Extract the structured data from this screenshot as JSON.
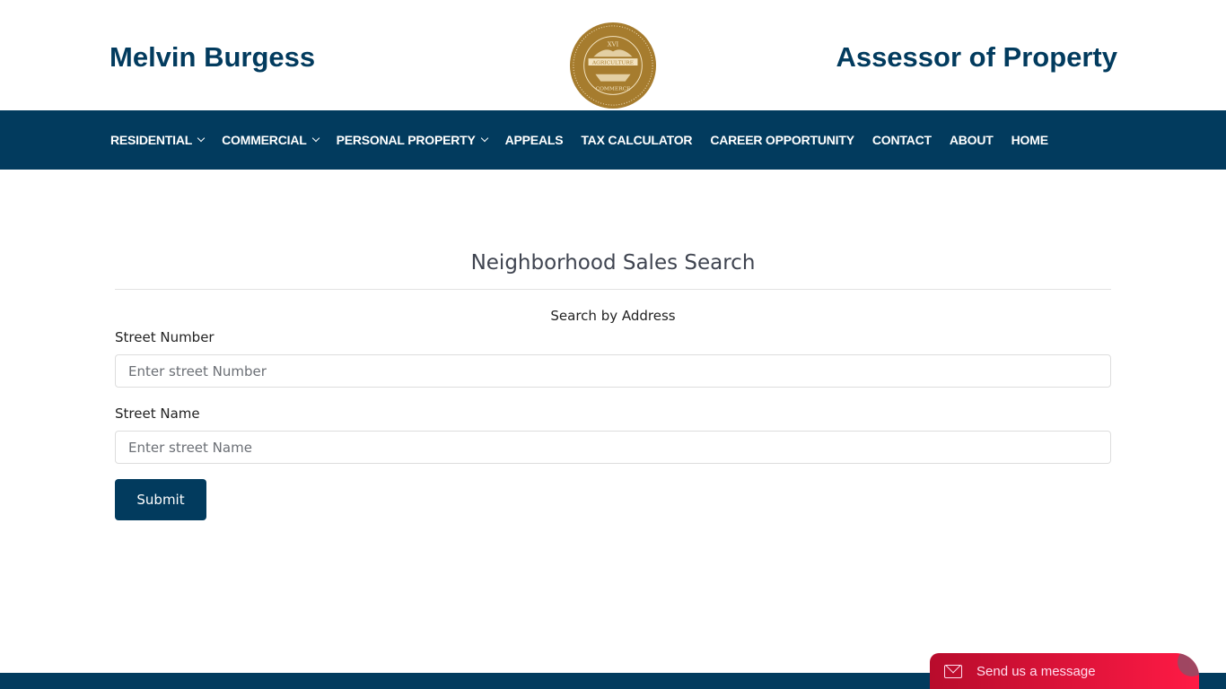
{
  "header": {
    "left_title": "Melvin Burgess",
    "right_title": "Assessor of Property",
    "seal": {
      "text": "THE SEAL OF SHELBY COUNTY TENNESSEE",
      "numeral": "XVI",
      "banner1": "AGRICULTURE",
      "banner2": "COMMERCE",
      "date": "NOVEMBER 24, 1819",
      "color": "#a67c2e"
    }
  },
  "nav": {
    "items": [
      {
        "label": "RESIDENTIAL",
        "dropdown": true
      },
      {
        "label": "COMMERCIAL",
        "dropdown": true
      },
      {
        "label": "PERSONAL PROPERTY",
        "dropdown": true
      },
      {
        "label": "APPEALS",
        "dropdown": false
      },
      {
        "label": "TAX CALCULATOR",
        "dropdown": false
      },
      {
        "label": "CAREER OPPORTUNITY",
        "dropdown": false
      },
      {
        "label": "CONTACT",
        "dropdown": false
      },
      {
        "label": "ABOUT",
        "dropdown": false
      },
      {
        "label": "HOME",
        "dropdown": false
      }
    ]
  },
  "main": {
    "title": "Neighborhood Sales Search",
    "subtitle": "Search by Address",
    "street_number": {
      "label": "Street Number",
      "placeholder": "Enter street Number",
      "value": ""
    },
    "street_name": {
      "label": "Street Name",
      "placeholder": "Enter street Name",
      "value": ""
    },
    "submit_label": "Submit"
  },
  "chat": {
    "label": "Send us a message",
    "icon": "mail-icon"
  },
  "colors": {
    "brand": "#023b5e",
    "chat": "#e8143c"
  }
}
